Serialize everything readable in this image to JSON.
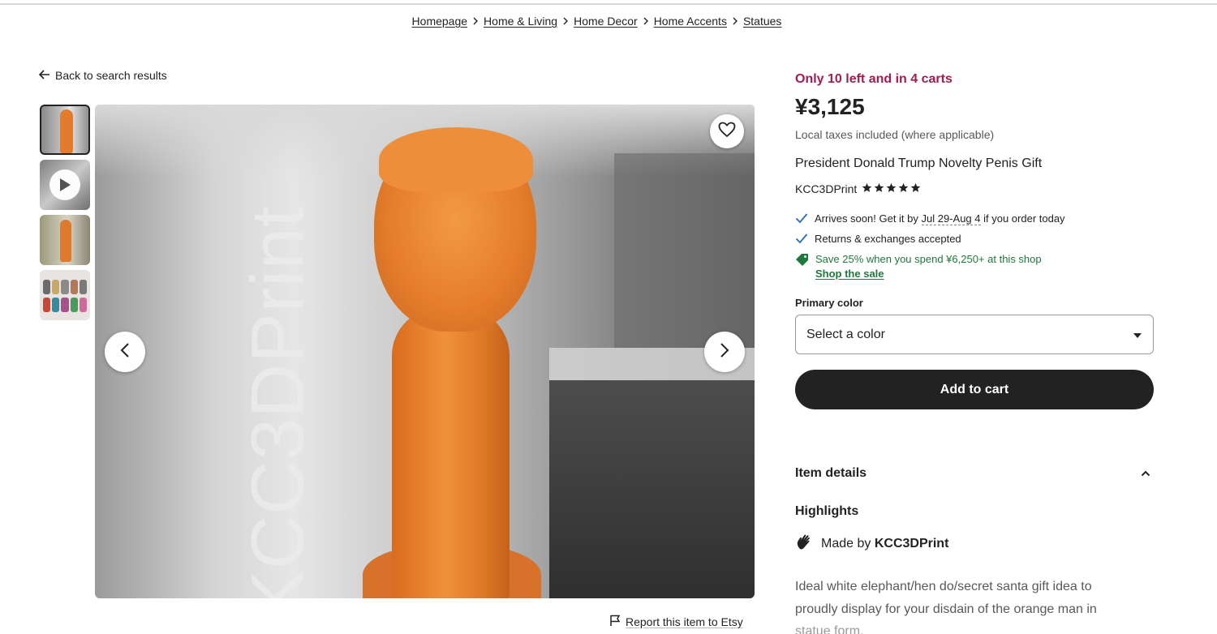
{
  "breadcrumb": {
    "items": [
      "Homepage",
      "Home & Living",
      "Home Decor",
      "Home Accents",
      "Statues"
    ]
  },
  "back_link": "Back to search results",
  "gallery": {
    "watermark": "KCC3DPrint",
    "thumbnail_count": 4
  },
  "report_link": "Report this item to Etsy",
  "listing": {
    "stock_note": "Only 10 left and in 4 carts",
    "price": "¥3,125",
    "tax_note": "Local taxes included (where applicable)",
    "title": "President Donald Trump Novelty Penis Gift",
    "shop_name": "KCC3DPrint",
    "rating_stars": 5
  },
  "features": {
    "arrival_prefix": "Arrives soon! Get it by ",
    "arrival_dates": "Jul 29-Aug 4",
    "arrival_suffix": " if you order today",
    "returns": "Returns & exchanges accepted",
    "sale": "Save 25% when you spend ¥6,250+ at this shop",
    "sale_link": "Shop the sale"
  },
  "color_select": {
    "label": "Primary color",
    "value": "Select a color"
  },
  "cart_button": "Add to cart",
  "details": {
    "heading": "Item details",
    "highlights": "Highlights",
    "made_by_prefix": "Made by",
    "made_by_shop": "KCC3DPrint",
    "description_line1": "Ideal white elephant/hen do/secret santa gift idea to",
    "description_line2": "proudly display for your disdain of the orange man in",
    "description_line3": "statue form."
  },
  "colors": {
    "stock_accent": "#a61a4f",
    "sale_green": "#1e7a3c",
    "cart_button_bg": "#222222",
    "statue_orange": "#e67e2c"
  }
}
